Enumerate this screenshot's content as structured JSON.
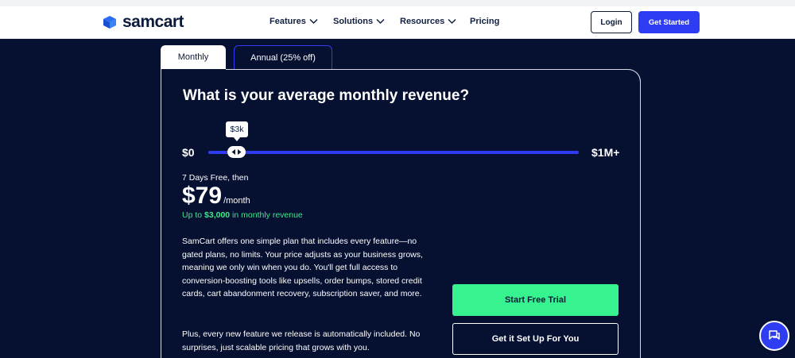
{
  "header": {
    "logo_text": "samcart",
    "nav": [
      {
        "label": "Features"
      },
      {
        "label": "Solutions"
      },
      {
        "label": "Resources"
      },
      {
        "label": "Pricing"
      }
    ],
    "login_label": "Login",
    "get_started_label": "Get Started"
  },
  "tabs": {
    "monthly": "Monthly",
    "annual": "Annual (25% off)",
    "active": "Monthly"
  },
  "pricing": {
    "question": "What is your average monthly revenue?",
    "slider": {
      "min_label": "$0",
      "max_label": "$1M+",
      "value_label": "$3k"
    },
    "trial_note": "7 Days Free, then",
    "price": "$79",
    "price_unit": "/month",
    "revenue_prefix": "Up to ",
    "revenue_amount": "$3,000",
    "revenue_suffix": " in monthly revenue",
    "description": "SamCart offers one simple plan that includes every feature—no gated plans, no limits. Your price adjusts as your business grows, meaning we only win when you do. You'll get full access to conversion-boosting tools like upsells, order bumps, stored credit cards, cart abandonment recovery, subscription saver, and more.",
    "description2": "Plus, every new feature we release is automatically included. No surprises, just scalable pricing that grows with you.",
    "start_trial_label": "Start Free Trial",
    "setup_label": "Get it Set Up For You"
  },
  "colors": {
    "background": "#061031",
    "accent_blue": "#2f3df2",
    "accent_green": "#37f38f"
  },
  "icons": {
    "logo": "cart-box-icon",
    "nav_dropdown": "chevron-down-icon",
    "slider_handle": "arrows-left-right-icon",
    "chat": "chat-bubble-icon"
  }
}
